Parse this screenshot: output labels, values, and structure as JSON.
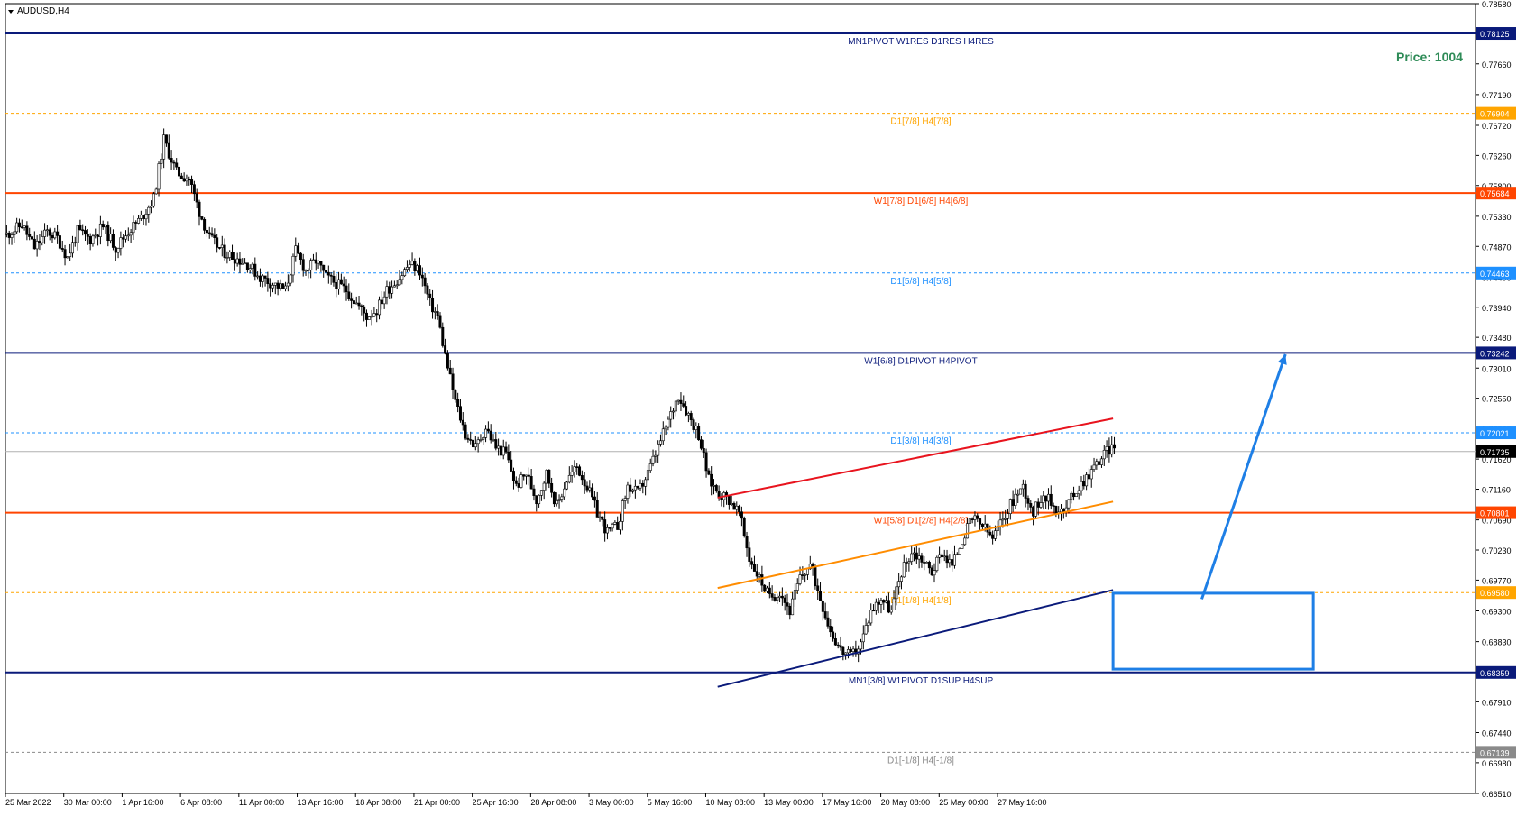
{
  "symbol_label": "AUDUSD,H4",
  "price_banner": "Price: 1004",
  "colors": {
    "navy": "#0a1a7a",
    "red_orange": "#ff4500",
    "orange": "#ffa500",
    "sky_blue": "#1e90ff",
    "gray": "#8a8a8a",
    "red_channel": "#e8141e",
    "orange_channel": "#ff8c00",
    "arrow_blue": "#1e7fe6",
    "box_blue": "#1e7fe6"
  },
  "chart_data": {
    "type": "candlestick",
    "title": "AUDUSD,H4",
    "ylim": [
      0.6651,
      0.7858
    ],
    "y_ticks": [
      "0.78580",
      "0.77660",
      "0.77190",
      "0.76720",
      "0.76260",
      "0.75800",
      "0.75330",
      "0.74870",
      "0.74400",
      "0.73940",
      "0.73480",
      "0.73010",
      "0.72550",
      "0.72090",
      "0.71620",
      "0.71160",
      "0.70690",
      "0.70230",
      "0.69770",
      "0.69300",
      "0.68830",
      "0.68370",
      "0.67910",
      "0.67440",
      "0.66980",
      "0.66510"
    ],
    "x_ticks": [
      "25 Mar 2022",
      "30 Mar 00:00",
      "1 Apr 16:00",
      "6 Apr 08:00",
      "11 Apr 00:00",
      "13 Apr 16:00",
      "18 Apr 08:00",
      "21 Apr 00:00",
      "25 Apr 16:00",
      "28 Apr 08:00",
      "3 May 00:00",
      "5 May 16:00",
      "10 May 08:00",
      "13 May 00:00",
      "17 May 16:00",
      "20 May 08:00",
      "25 May 00:00",
      "27 May 16:00"
    ],
    "current_price": "0.71735",
    "levels": [
      {
        "price": 0.78125,
        "tag": "0.78125",
        "label": "MN1PIVOT W1RES D1RES H4RES",
        "style": "solid",
        "color": "navy"
      },
      {
        "price": 0.76904,
        "tag": "0.76904",
        "label": "D1[7/8] H4[7/8]",
        "style": "dashed",
        "color": "orange"
      },
      {
        "price": 0.75684,
        "tag": "0.75684",
        "label": "W1[7/8] D1[6/8] H4[6/8]",
        "style": "solid",
        "color": "red_orange"
      },
      {
        "price": 0.74463,
        "tag": "0.74463",
        "label": "D1[5/8] H4[5/8]",
        "style": "dashed",
        "color": "sky_blue"
      },
      {
        "price": 0.73242,
        "tag": "0.73242",
        "label": "W1[6/8] D1PIVOT H4PIVOT",
        "style": "solid",
        "color": "navy"
      },
      {
        "price": 0.72021,
        "tag": "0.72021",
        "label": "D1[3/8] H4[3/8]",
        "style": "dashed",
        "color": "sky_blue"
      },
      {
        "price": 0.70801,
        "tag": "0.70801",
        "label": "W1[5/8] D1[2/8] H4[2/8]",
        "style": "solid",
        "color": "red_orange"
      },
      {
        "price": 0.6958,
        "tag": "0.69580",
        "label": "D1[1/8] H4[1/8]",
        "style": "dashed",
        "color": "orange"
      },
      {
        "price": 0.68359,
        "tag": "0.68359",
        "label": "MN1[3/8] W1PIVOT D1SUP H4SUP",
        "style": "solid",
        "color": "navy"
      },
      {
        "price": 0.67139,
        "tag": "0.67139",
        "label": "D1[-1/8] H4[-1/8]",
        "style": "dashed",
        "color": "gray"
      }
    ],
    "price_path": [
      [
        0,
        0.7505
      ],
      [
        6,
        0.752
      ],
      [
        11,
        0.7485
      ],
      [
        16,
        0.751
      ],
      [
        20,
        0.75
      ],
      [
        24,
        0.747
      ],
      [
        28,
        0.751
      ],
      [
        33,
        0.7498
      ],
      [
        38,
        0.7518
      ],
      [
        43,
        0.7485
      ],
      [
        48,
        0.751
      ],
      [
        53,
        0.753
      ],
      [
        58,
        0.756
      ],
      [
        62,
        0.765
      ],
      [
        67,
        0.76
      ],
      [
        72,
        0.759
      ],
      [
        76,
        0.754
      ],
      [
        80,
        0.75
      ],
      [
        85,
        0.748
      ],
      [
        90,
        0.747
      ],
      [
        95,
        0.746
      ],
      [
        100,
        0.744
      ],
      [
        105,
        0.743
      ],
      [
        110,
        0.742
      ],
      [
        114,
        0.748
      ],
      [
        118,
        0.745
      ],
      [
        122,
        0.7465
      ],
      [
        126,
        0.744
      ],
      [
        130,
        0.743
      ],
      [
        134,
        0.742
      ],
      [
        138,
        0.74
      ],
      [
        142,
        0.738
      ],
      [
        146,
        0.739
      ],
      [
        150,
        0.742
      ],
      [
        155,
        0.744
      ],
      [
        159,
        0.746
      ],
      [
        163,
        0.745
      ],
      [
        167,
        0.74
      ],
      [
        170,
        0.738
      ],
      [
        173,
        0.732
      ],
      [
        177,
        0.725
      ],
      [
        181,
        0.72
      ],
      [
        185,
        0.718
      ],
      [
        189,
        0.721
      ],
      [
        193,
        0.718
      ],
      [
        197,
        0.717
      ],
      [
        201,
        0.712
      ],
      [
        205,
        0.714
      ],
      [
        209,
        0.71
      ],
      [
        213,
        0.714
      ],
      [
        217,
        0.709
      ],
      [
        221,
        0.713
      ],
      [
        225,
        0.715
      ],
      [
        229,
        0.712
      ],
      [
        233,
        0.708
      ],
      [
        237,
        0.705
      ],
      [
        241,
        0.706
      ],
      [
        245,
        0.712
      ],
      [
        249,
        0.711
      ],
      [
        253,
        0.714
      ],
      [
        257,
        0.718
      ],
      [
        261,
        0.722
      ],
      [
        265,
        0.726
      ],
      [
        269,
        0.723
      ],
      [
        273,
        0.72
      ],
      [
        277,
        0.713
      ],
      [
        281,
        0.711
      ],
      [
        285,
        0.71
      ],
      [
        289,
        0.708
      ],
      [
        293,
        0.701
      ],
      [
        297,
        0.698
      ],
      [
        301,
        0.695
      ],
      [
        305,
        0.696
      ],
      [
        309,
        0.693
      ],
      [
        313,
        0.698
      ],
      [
        317,
        0.7
      ],
      [
        321,
        0.695
      ],
      [
        325,
        0.69
      ],
      [
        329,
        0.687
      ],
      [
        333,
        0.686
      ],
      [
        337,
        0.688
      ],
      [
        341,
        0.693
      ],
      [
        345,
        0.695
      ],
      [
        349,
        0.693
      ],
      [
        353,
        0.699
      ],
      [
        357,
        0.702
      ],
      [
        361,
        0.701
      ],
      [
        365,
        0.699
      ],
      [
        369,
        0.702
      ],
      [
        373,
        0.7
      ],
      [
        377,
        0.704
      ],
      [
        381,
        0.707
      ],
      [
        385,
        0.706
      ],
      [
        389,
        0.704
      ],
      [
        393,
        0.707
      ],
      [
        397,
        0.71
      ],
      [
        401,
        0.712
      ],
      [
        405,
        0.708
      ],
      [
        409,
        0.711
      ],
      [
        413,
        0.709
      ],
      [
        417,
        0.708
      ],
      [
        421,
        0.711
      ],
      [
        425,
        0.713
      ],
      [
        429,
        0.715
      ],
      [
        433,
        0.717
      ],
      [
        437,
        0.7185
      ]
    ],
    "drawings": {
      "red_channel_line": [
        [
          281,
          0.7103
        ],
        [
          437,
          0.7224
        ]
      ],
      "orange_channel_line": [
        [
          281,
          0.6965
        ],
        [
          437,
          0.7097
        ]
      ],
      "navy_support_line": [
        [
          281,
          0.6814
        ],
        [
          437,
          0.6962
        ]
      ],
      "target_box": {
        "x_from": 437,
        "x_to": 516,
        "y_high": 0.6957,
        "y_low": 0.6841
      },
      "forecast_arrow": [
        [
          472,
          0.6948
        ],
        [
          505,
          0.7322
        ]
      ]
    }
  }
}
